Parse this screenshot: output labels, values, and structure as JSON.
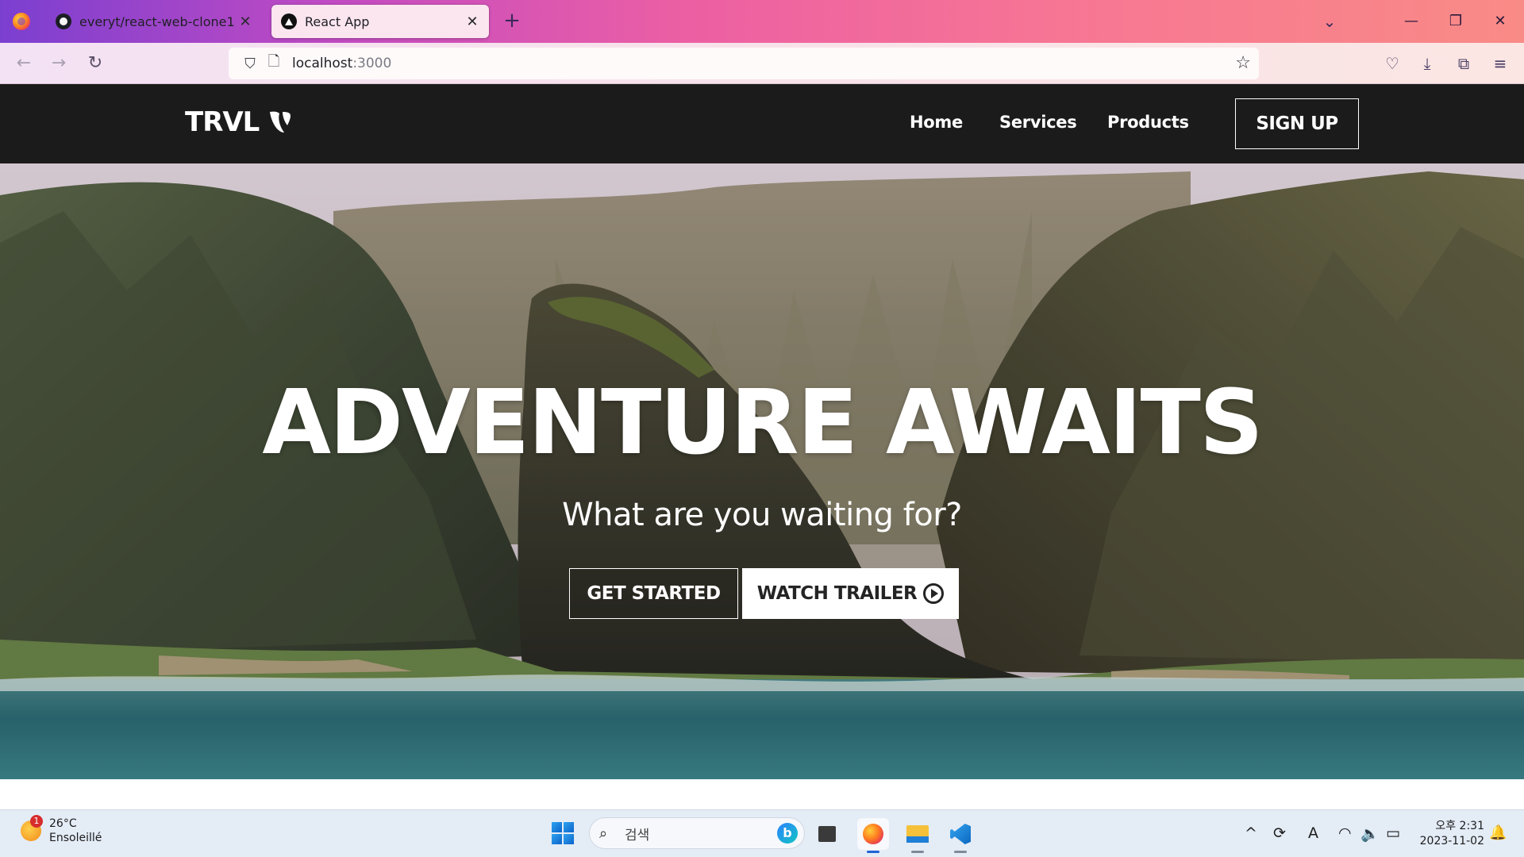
{
  "browser": {
    "tabs": [
      {
        "title": "everyt/react-web-clone1",
        "icon": "github-icon",
        "active": false
      },
      {
        "title": "React App",
        "icon": "react-app-icon",
        "active": true
      }
    ],
    "new_tab_symbol": "+",
    "url": {
      "host": "localhost",
      "port": ":3000"
    },
    "icons": {
      "back": "←",
      "forward": "→",
      "reload": "↻",
      "shield": "⛉",
      "page": "🗋",
      "bookmark": "☆",
      "pocket": "♡",
      "download": "⤓",
      "extensions": "⧉",
      "menu": "≡",
      "list_all_tabs": "⌄",
      "minimize": "—",
      "restore": "❐",
      "close": "✕",
      "tab_close": "✕"
    }
  },
  "site": {
    "logo_text": "TRVL",
    "nav": [
      {
        "label": "Home"
      },
      {
        "label": "Services"
      },
      {
        "label": "Products"
      }
    ],
    "signup_label": "SIGN UP",
    "hero": {
      "title": "ADVENTURE AWAITS",
      "subtitle": "What are you waiting for?",
      "primary_button": "GET STARTED",
      "secondary_button": "WATCH TRAILER"
    }
  },
  "taskbar": {
    "weather": {
      "temp": "26°C",
      "condition": "Ensoleillé",
      "badge": "1"
    },
    "search_placeholder": "검색",
    "bing_letter": "b",
    "tray_icons": {
      "chevron": "^",
      "sync": "⟳",
      "ime": "A",
      "wifi": "◠",
      "volume": "🔈",
      "battery": "▭"
    },
    "clock": {
      "time": "오후 2:31",
      "date": "2023-11-02"
    },
    "notification_icon": "🔔"
  },
  "colors": {
    "site_nav_bg": "#1c1b1b",
    "tabbar_gradient": [
      "#7b3fd0",
      "#ec5fa3",
      "#f98b86"
    ],
    "taskbar_bg": "#e4ecf6"
  }
}
